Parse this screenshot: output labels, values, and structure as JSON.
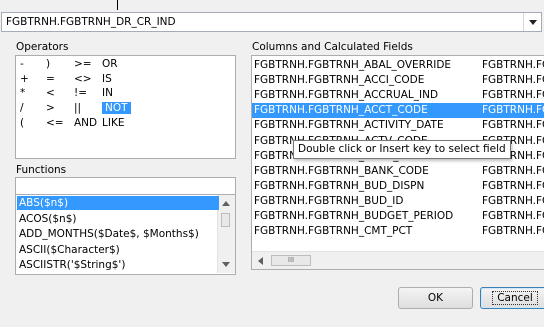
{
  "expression": {
    "value": "FGBTRNH.FGBTRNH_DR_CR_IND"
  },
  "operators": {
    "label": "Operators",
    "rows": [
      [
        "-",
        ")",
        ">=",
        "OR"
      ],
      [
        "+",
        "=",
        "<>",
        "IS"
      ],
      [
        "*",
        "<",
        "!=",
        "IN"
      ],
      [
        "/",
        ">",
        "||",
        "NOT"
      ],
      [
        "(",
        "<=",
        "AND",
        "LIKE"
      ]
    ],
    "selected": "NOT"
  },
  "functions": {
    "label": "Functions",
    "search_value": "",
    "items": [
      "ABS($n$)",
      "ACOS($n$)",
      "ADD_MONTHS($Date$, $Months$)",
      "ASCII($Character$)",
      "ASCIISTR('$String$')"
    ],
    "selected_index": 0
  },
  "columns": {
    "label": "Columns and Calculated Fields",
    "rows": [
      {
        "a": "FGBTRNH.FGBTRNH_ABAL_OVERRIDE",
        "b": "FGBTRNH.FG"
      },
      {
        "a": "FGBTRNH.FGBTRNH_ACCI_CODE",
        "b": "FGBTRNH.FG"
      },
      {
        "a": "FGBTRNH.FGBTRNH_ACCRUAL_IND",
        "b": "FGBTRNH.FG"
      },
      {
        "a": "FGBTRNH.FGBTRNH_ACCT_CODE",
        "b": "FGBTRNH.FG"
      },
      {
        "a": "FGBTRNH.FGBTRNH_ACTIVITY_DATE",
        "b": "FGBTRNH.FG"
      },
      {
        "a": "FGBTRNH.FGBTRNH_ACTV_CODE",
        "b": "FGBTRNH.FG"
      },
      {
        "a": "FGBTRNH.FGBTRNH_BANK_CODE",
        "b": "FGBTRNH.FG"
      },
      {
        "a": "FGBTRNH.FGBTRNH_BANK_CODE",
        "b": "FGBTRNH.FG"
      },
      {
        "a": "FGBTRNH.FGBTRNH_BUD_DISPN",
        "b": "FGBTRNH.FG"
      },
      {
        "a": "FGBTRNH.FGBTRNH_BUD_ID",
        "b": "FGBTRNH.FG"
      },
      {
        "a": "FGBTRNH.FGBTRNH_BUDGET_PERIOD",
        "b": "FGBTRNH.FG"
      },
      {
        "a": "FGBTRNH.FGBTRNH_CMT_PCT",
        "b": "FGBTRNH.FG"
      }
    ],
    "selected_index": 3,
    "tooltip": "Double click or Insert key to select field",
    "hscroll_grip": "III"
  },
  "buttons": {
    "ok": "OK",
    "cancel": "Cancel"
  }
}
